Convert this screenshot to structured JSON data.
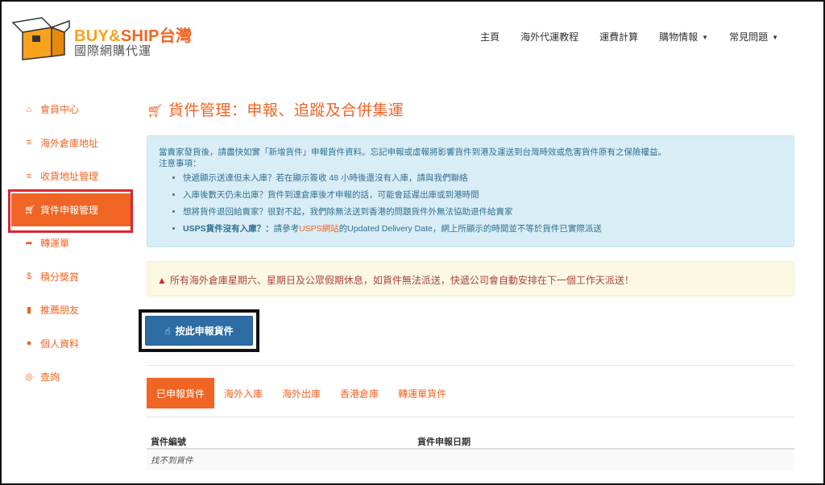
{
  "brand": {
    "name_part1": "BUY&",
    "name_part2": "SHIP",
    "name_part3": "台灣",
    "subtitle": "國際網購代運",
    "colors": {
      "accent": "#f06424",
      "accent_light": "#f7a21b",
      "primary_button": "#2d6da3",
      "highlight_border": "#d9272e"
    }
  },
  "topnav": {
    "items": [
      {
        "label": "主頁"
      },
      {
        "label": "海外代運教程"
      },
      {
        "label": "運費計算"
      },
      {
        "label": "購物情報",
        "has_dropdown": true
      },
      {
        "label": "常見問題",
        "has_dropdown": true
      }
    ]
  },
  "sidebar": {
    "items": [
      {
        "label": "會員中心",
        "icon": "home-icon"
      },
      {
        "label": "海外倉庫地址",
        "icon": "list-icon"
      },
      {
        "label": "收貨地址管理",
        "icon": "list-icon"
      },
      {
        "label": "貨件申報管理",
        "icon": "cart-icon",
        "active": true
      },
      {
        "label": "轉運單",
        "icon": "share-icon"
      },
      {
        "label": "積分獎賞",
        "icon": "dollar-icon"
      },
      {
        "label": "推薦朋友",
        "icon": "chart-icon"
      },
      {
        "label": "個人資料",
        "icon": "user-icon"
      },
      {
        "label": "查詢",
        "icon": "lifebuoy-icon"
      }
    ]
  },
  "main": {
    "title": "貨件管理：申報、追蹤及合併集運",
    "info": {
      "intro": "當賣家發貨後，請盡快如實「新增貨件」申報貨件資料。忘記申報或虛報將影響貨件到港及運送到台灣時效或危害貨件原有之保險權益。",
      "notes_label": "注意事項：",
      "bullets": [
        "快遞顯示送達但未入庫？若在顯示簽收 48 小時後還沒有入庫，請與我們聯絡",
        "入庫後數天仍未出庫？貨件到達倉庫後才申報的話，可能會延遲出庫或到港時間",
        "想將貨件退回給賣家？很對不起，我們除無法送到香港的問題貨件外無法協助退件給賣家"
      ],
      "usps_bold": "USPS貨件沒有入庫？：",
      "usps_pre": "請參考",
      "usps_link": "USPS網站",
      "usps_post": "的Updated Delivery Date，網上所顯示的時間並不等於貨件已實際派送"
    },
    "warning": "所有海外倉庫星期六、星期日及公眾假期休息，如貨件無法派送，快遞公司會自動安排在下一個工作天派送！",
    "declare_button": "按此申報貨件",
    "tabs": [
      {
        "label": "已申報貨件",
        "active": true
      },
      {
        "label": "海外入庫"
      },
      {
        "label": "海外出庫"
      },
      {
        "label": "香港倉庫"
      },
      {
        "label": "轉運單貨件"
      }
    ],
    "table": {
      "headers": [
        "貨件編號",
        "貨件申報日期"
      ],
      "empty_text": "找不到貨件"
    }
  }
}
